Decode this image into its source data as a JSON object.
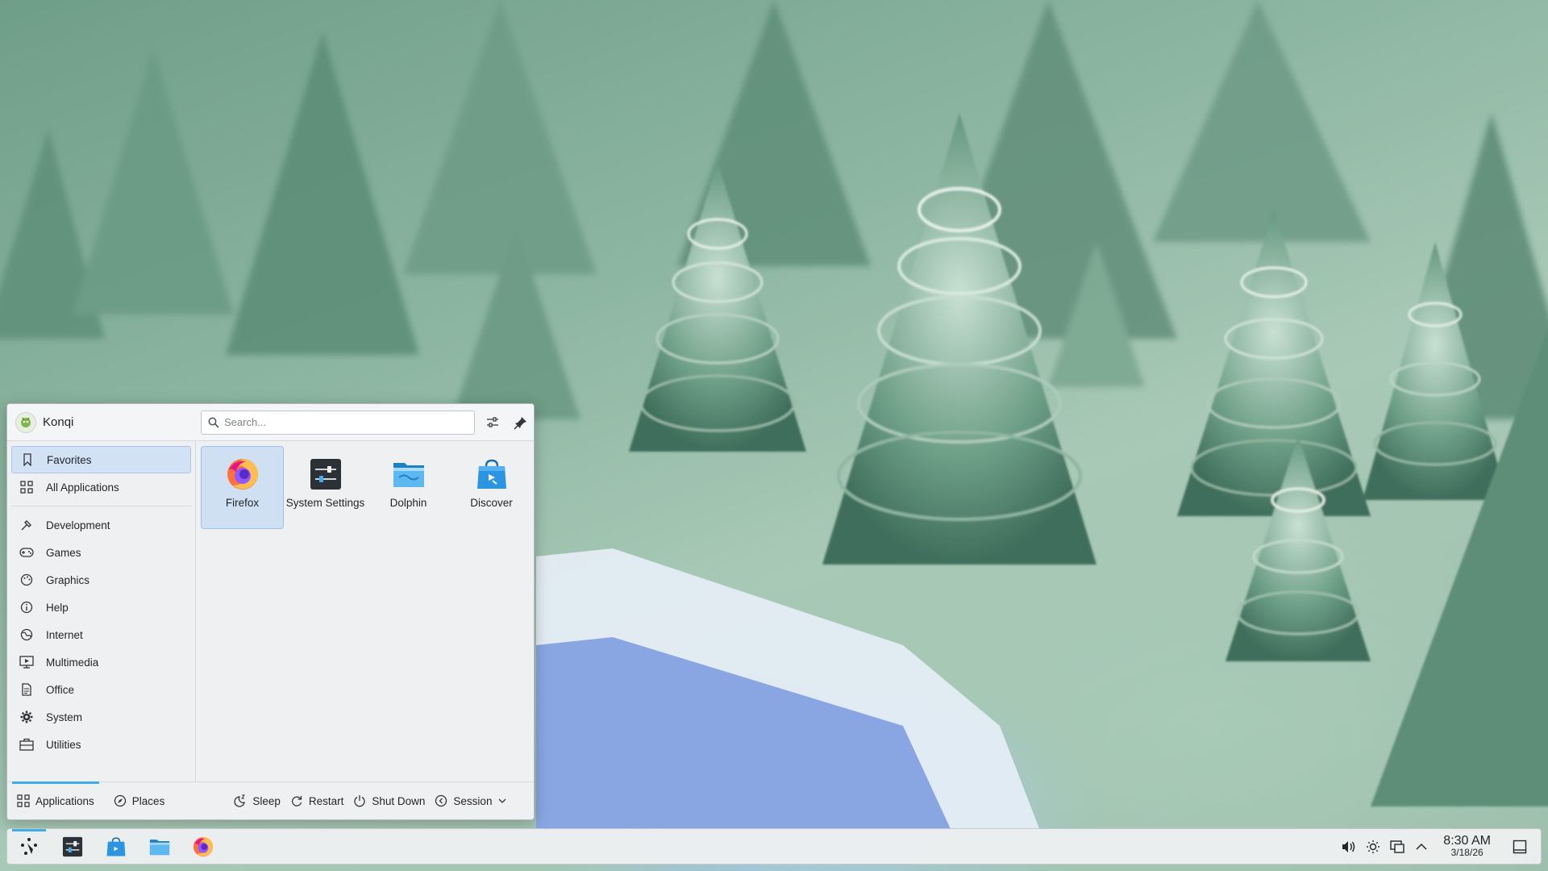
{
  "user": {
    "name": "Konqi"
  },
  "search": {
    "placeholder": "Search..."
  },
  "sidebar": {
    "primary": [
      {
        "label": "Favorites",
        "icon": "bookmark-icon",
        "selected": true
      },
      {
        "label": "All Applications",
        "icon": "grid-icon",
        "selected": false
      }
    ],
    "categories": [
      {
        "label": "Development",
        "icon": "hammer-icon"
      },
      {
        "label": "Games",
        "icon": "gamepad-icon"
      },
      {
        "label": "Graphics",
        "icon": "palette-icon"
      },
      {
        "label": "Help",
        "icon": "info-icon"
      },
      {
        "label": "Internet",
        "icon": "globe-icon"
      },
      {
        "label": "Multimedia",
        "icon": "monitor-play-icon"
      },
      {
        "label": "Office",
        "icon": "document-icon"
      },
      {
        "label": "System",
        "icon": "gear-icon"
      },
      {
        "label": "Utilities",
        "icon": "toolbox-icon"
      }
    ]
  },
  "favorites": [
    {
      "label": "Firefox",
      "icon": "firefox-icon",
      "selected": true
    },
    {
      "label": "System Settings",
      "icon": "system-settings-icon",
      "selected": false
    },
    {
      "label": "Dolphin",
      "icon": "dolphin-folder-icon",
      "selected": false
    },
    {
      "label": "Discover",
      "icon": "discover-bag-icon",
      "selected": false
    }
  ],
  "footer": {
    "applications": "Applications",
    "places": "Places",
    "sleep": "Sleep",
    "restart": "Restart",
    "shutdown": "Shut Down",
    "session": "Session"
  },
  "taskbar": {
    "apps": [
      "kde-launcher-icon",
      "system-settings-icon",
      "discover-bag-icon",
      "dolphin-folder-icon",
      "firefox-icon"
    ]
  },
  "tray": {
    "icons": [
      "volume-icon",
      "brightness-icon",
      "display-icon",
      "chevron-up-icon"
    ],
    "time": "8:30 AM",
    "date": "3/18/26"
  },
  "colors": {
    "accent": "#3daee9",
    "selection": "#d2e2f4",
    "panel": "#eff0f1"
  }
}
